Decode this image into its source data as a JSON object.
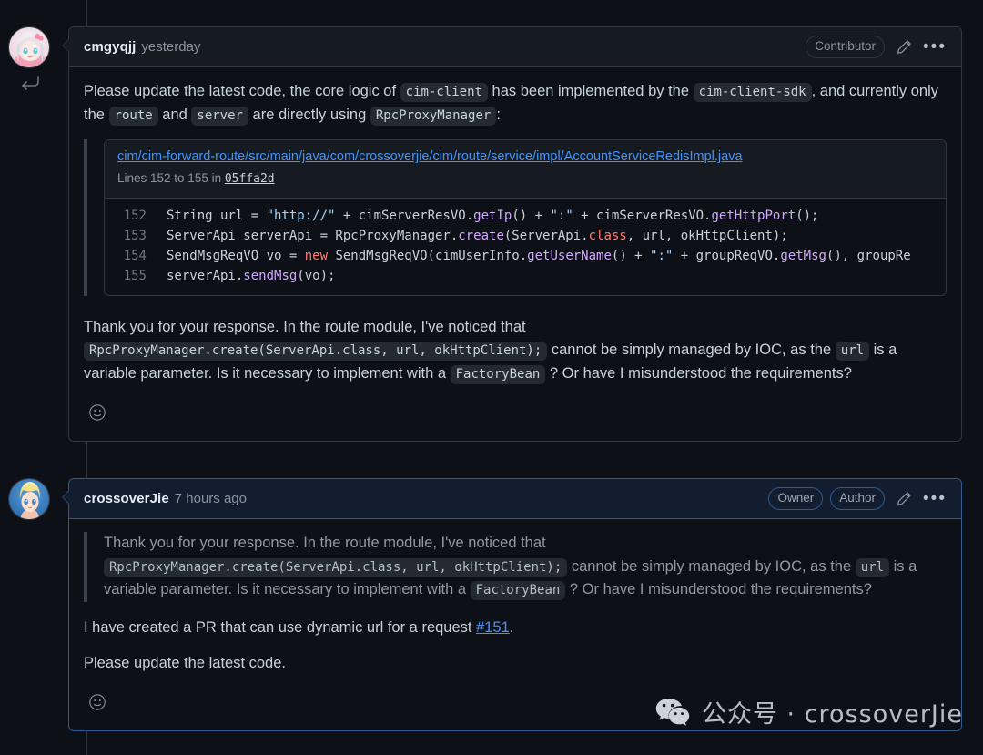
{
  "comments": [
    {
      "author": "cmgyqjj",
      "timestamp": "yesterday",
      "badges": [
        "Contributor"
      ],
      "edit_icon": "pencil-icon",
      "menu_icon": "kebab-menu-icon",
      "reaction_icon": "smiley-face-icon",
      "paragraph1": {
        "t1": "Please update the latest code, the core logic of ",
        "c1": "cim-client",
        "t2": " has been implemented by the ",
        "c2": "cim-client-sdk",
        "t3": ", and currently only the ",
        "c3": "route",
        "t4": " and ",
        "c4": "server",
        "t5": " are directly using ",
        "c5": "RpcProxyManager",
        "t6": ":"
      },
      "snippet": {
        "path": "cim/cim-forward-route/src/main/java/com/crossoverjie/cim/route/service/impl/AccountServiceRedisImpl.java",
        "lines_label_pre": "Lines 152 to 155 in ",
        "commit_sha": "05ffa2d",
        "rows": [
          {
            "number": "152",
            "code": "String url = \"http://\" + cimServerResVO.getIp() + \":\" + cimServerResVO.getHttpPort();"
          },
          {
            "number": "153",
            "code": "ServerApi serverApi = RpcProxyManager.create(ServerApi.class, url, okHttpClient);"
          },
          {
            "number": "154",
            "code": "SendMsgReqVO vo = new SendMsgReqVO(cimUserInfo.getUserName() + \":\" + groupReqVO.getMsg(), groupRe"
          },
          {
            "number": "155",
            "code": "serverApi.sendMsg(vo);"
          }
        ]
      },
      "paragraph2": {
        "t1": "Thank you for your response. In the route module, I've noticed that ",
        "c1": "RpcProxyManager.create(ServerApi.class, url, okHttpClient);",
        "t2": " cannot be simply managed by IOC, as the ",
        "c2": "url",
        "t3": " is a variable parameter. Is it necessary to implement with a ",
        "c3": "FactoryBean",
        "t4": " ? Or have I misunderstood the requirements?"
      }
    },
    {
      "author": "crossoverJie",
      "timestamp": "7 hours ago",
      "badges": [
        "Owner",
        "Author"
      ],
      "edit_icon": "pencil-icon",
      "menu_icon": "kebab-menu-icon",
      "reaction_icon": "smiley-face-icon",
      "quote": {
        "t1": "Thank you for your response. In the route module, I've noticed that ",
        "c1": "RpcProxyManager.create(ServerApi.class, url, okHttpClient);",
        "t2": " cannot be simply managed by IOC, as the ",
        "c2": "url",
        "t3": " is a variable parameter. Is it necessary to implement with a ",
        "c3": "FactoryBean",
        "t4": " ? Or have I misunderstood the requirements?"
      },
      "paragraph1": {
        "t1": "I have created a PR that can use dynamic url for a request ",
        "link": "#151",
        "t2": "."
      },
      "paragraph2": "Please update the latest code."
    }
  ],
  "watermark": {
    "icon": "wechat-icon",
    "text": "公众号 · crossoverJie"
  },
  "colors": {
    "background": "#0d1117",
    "border": "#30363d",
    "border_highlight": "#2f5a8c",
    "header_bg": "#161b22",
    "header_bg_highlight": "#121d2f",
    "text": "#c9d1d9",
    "muted": "#8b949e",
    "link": "#4493f8"
  }
}
